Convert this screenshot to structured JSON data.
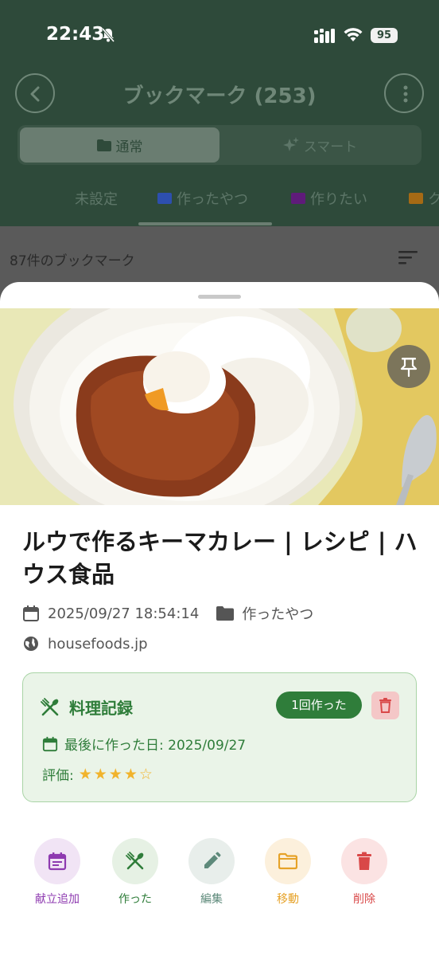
{
  "status_bar": {
    "time": "22:43",
    "battery": "95"
  },
  "nav": {
    "title": "ブックマーク (253)"
  },
  "segment": {
    "normal_label": "通常",
    "smart_label": "スマート"
  },
  "folder_tabs": [
    {
      "label": "未設定",
      "color": ""
    },
    {
      "label": "作ったやつ",
      "color": "#2d4fae"
    },
    {
      "label": "作りたい",
      "color": "#5f1b7a"
    },
    {
      "label": "ク",
      "color": "#a66a14"
    }
  ],
  "list": {
    "count_text": "87件のブックマーク"
  },
  "sheet": {
    "title": "ルウで作るキーマカレー | レシピ | ハウス食品",
    "date": "2025/09/27 18:54:14",
    "folder": "作ったやつ",
    "domain": "housefoods.jp",
    "cooking": {
      "title": "料理記録",
      "count_badge": "1回作った",
      "last_cooked": "最後に作った日: 2025/09/27",
      "rating_label": "評価:",
      "rating_stars": "★★★★☆",
      "rating_value": 4
    },
    "actions": [
      {
        "label": "献立追加",
        "color": "#8e3ab0",
        "bg": "#f1e4f5",
        "icon": "calendar-icon"
      },
      {
        "label": "作った",
        "color": "#2f7d3a",
        "bg": "#e6f1e4",
        "icon": "utensils-icon"
      },
      {
        "label": "編集",
        "color": "#5e8a7b",
        "bg": "#e8eeeb",
        "icon": "edit-icon"
      },
      {
        "label": "移動",
        "color": "#e6a228",
        "bg": "#fcf0dc",
        "icon": "folder-icon"
      },
      {
        "label": "削除",
        "color": "#d94848",
        "bg": "#fbe3e3",
        "icon": "trash-icon"
      }
    ]
  }
}
